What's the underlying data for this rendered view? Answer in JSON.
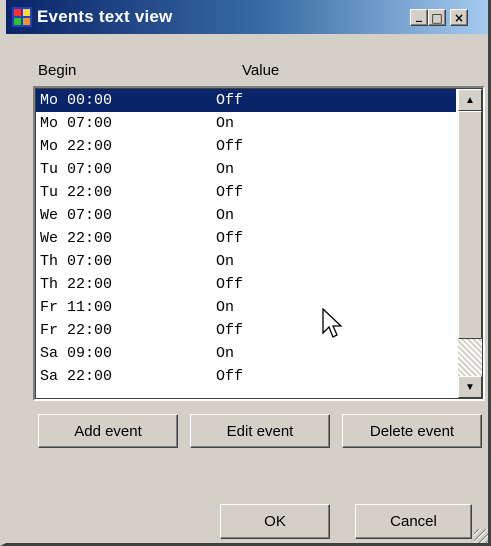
{
  "window": {
    "title": "Events text view",
    "controls": {
      "minimize": "_",
      "maximize": "□",
      "close": "×"
    }
  },
  "list": {
    "headers": {
      "begin": "Begin",
      "value": "Value"
    },
    "selected_index": 0,
    "rows": [
      {
        "begin": "Mo 00:00",
        "value": "Off"
      },
      {
        "begin": "Mo 07:00",
        "value": "On"
      },
      {
        "begin": "Mo 22:00",
        "value": "Off"
      },
      {
        "begin": "Tu 07:00",
        "value": "On"
      },
      {
        "begin": "Tu 22:00",
        "value": "Off"
      },
      {
        "begin": "We 07:00",
        "value": "On"
      },
      {
        "begin": "We 22:00",
        "value": "Off"
      },
      {
        "begin": "Th 07:00",
        "value": "On"
      },
      {
        "begin": "Th 22:00",
        "value": "Off"
      },
      {
        "begin": "Fr 11:00",
        "value": "On"
      },
      {
        "begin": "Fr 22:00",
        "value": "Off"
      },
      {
        "begin": "Sa 09:00",
        "value": "On"
      },
      {
        "begin": "Sa 22:00",
        "value": "Off"
      }
    ],
    "scroll_up": "▲",
    "scroll_down": "▼"
  },
  "actions": {
    "add": "Add event",
    "edit": "Edit event",
    "delete": "Delete event"
  },
  "dialog_buttons": {
    "ok": "OK",
    "cancel": "Cancel"
  },
  "colors": {
    "selection": "#0a246a",
    "face": "#d4d0c8"
  }
}
